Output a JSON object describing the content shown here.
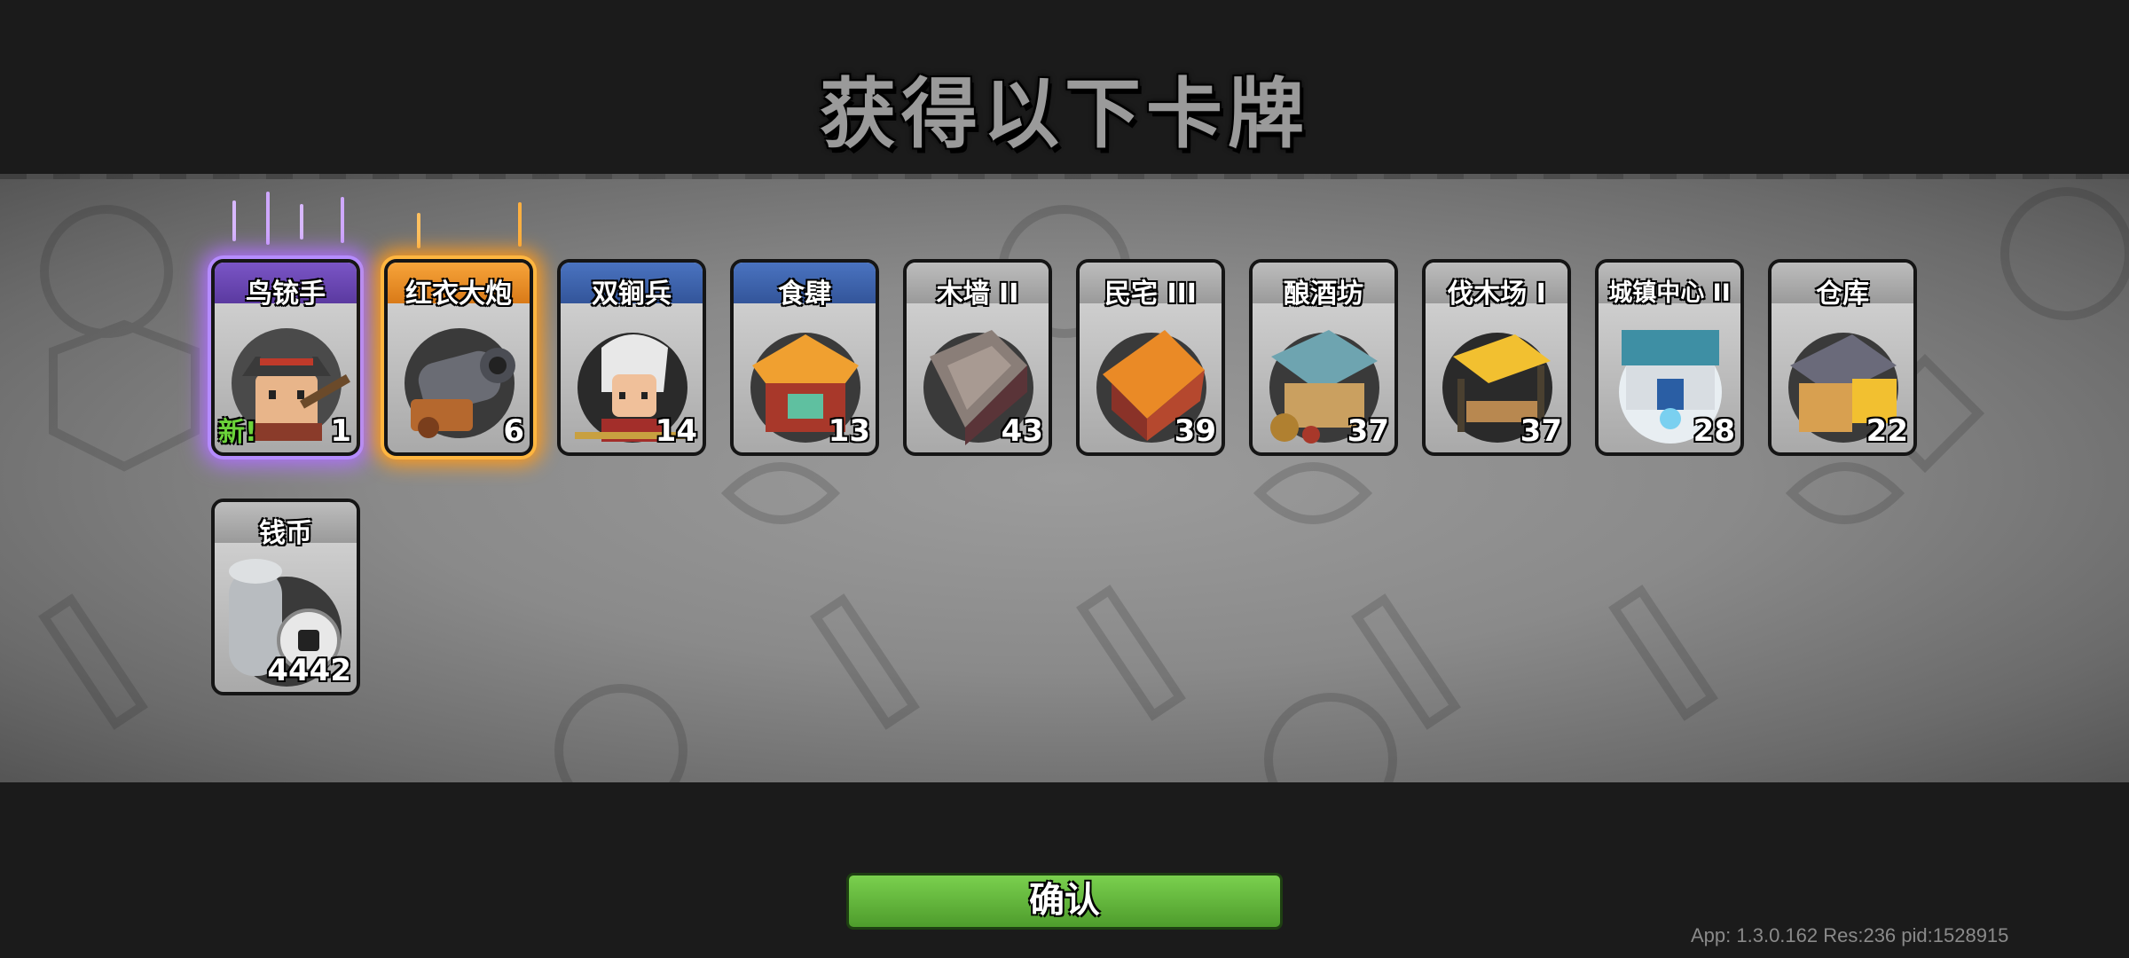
{
  "header": {
    "title": "获得以下卡牌"
  },
  "cards": [
    {
      "name": "鸟铳手",
      "count": "1",
      "new_label": "新!",
      "icon": "musketeer-icon"
    },
    {
      "name": "红衣大炮",
      "count": "6",
      "icon": "cannon-icon"
    },
    {
      "name": "双锏兵",
      "count": "14",
      "icon": "warrior-icon"
    },
    {
      "name": "食肆",
      "count": "13",
      "icon": "restaurant-icon"
    },
    {
      "name": "木墙 II",
      "count": "43",
      "icon": "wooden-wall-icon"
    },
    {
      "name": "民宅 III",
      "count": "39",
      "icon": "house-icon"
    },
    {
      "name": "酿酒坊",
      "count": "37",
      "icon": "brewery-icon"
    },
    {
      "name": "伐木场 I",
      "count": "37",
      "icon": "lumber-mill-icon"
    },
    {
      "name": "城镇中心 II",
      "count": "28",
      "icon": "town-center-icon"
    },
    {
      "name": "仓库",
      "count": "22",
      "icon": "warehouse-icon"
    },
    {
      "name": "钱币",
      "count": "4442",
      "icon": "coin-icon"
    }
  ],
  "confirm_label": "确认",
  "version_text": "App: 1.3.0.162 Res:236 pid:1528915",
  "colors": {
    "confirm": "#5fb43a",
    "rare_glow": "#b070ff",
    "epic_glow": "#ff9a1a",
    "new_tag": "#6bd33a"
  }
}
